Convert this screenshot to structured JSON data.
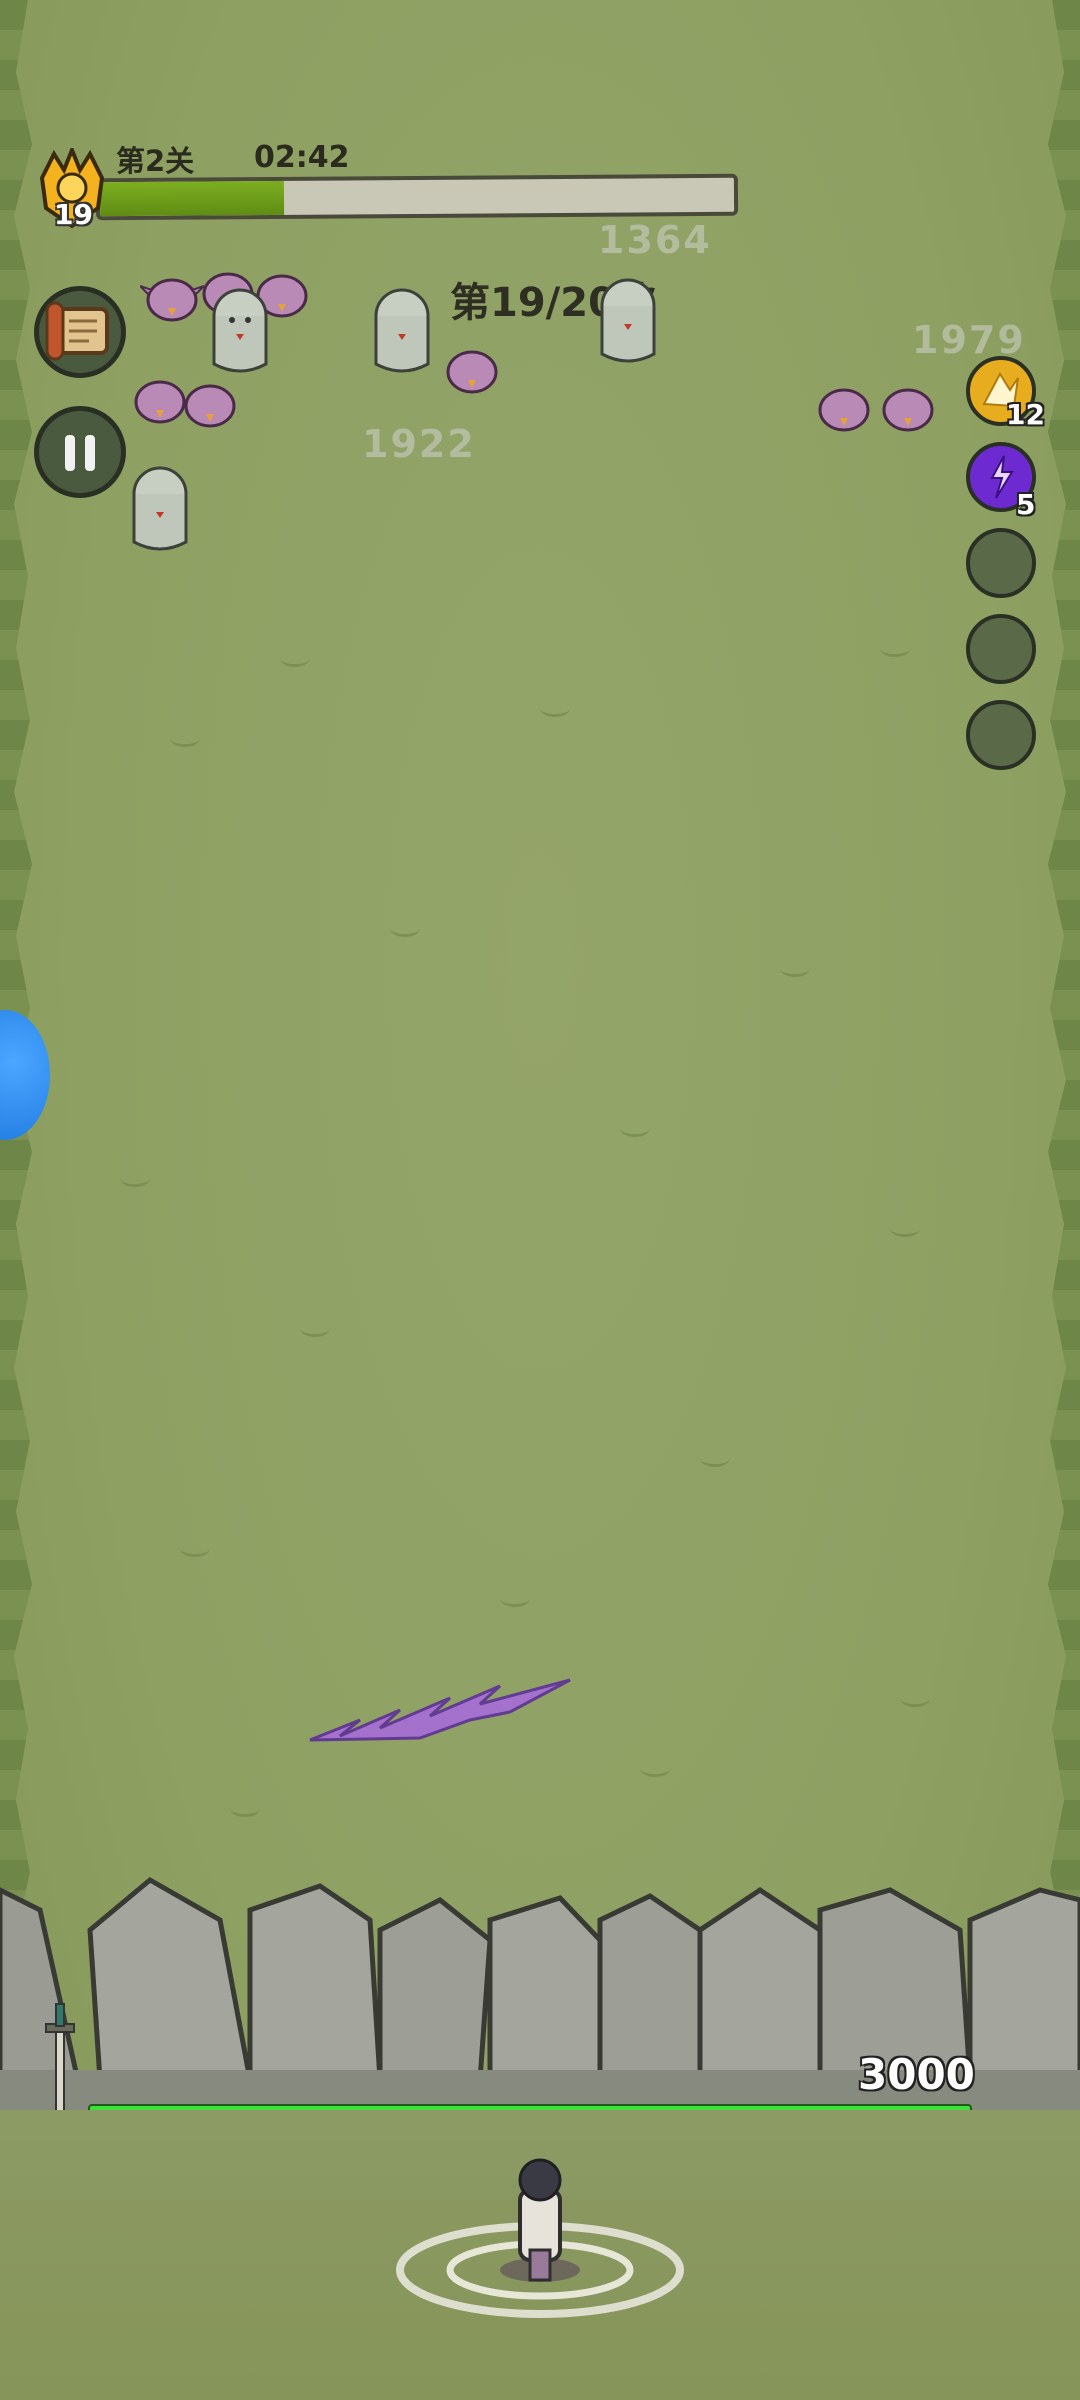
{
  "hud": {
    "player_level": "19",
    "stage_label": "第2关",
    "timer": "02:42",
    "progress_fraction": 0.29,
    "wave_label": "第19/20波"
  },
  "damage_numbers": [
    "1364",
    "1979",
    "1922"
  ],
  "skills": [
    {
      "icon": "wing-skill-icon",
      "color": "#e7ad1f",
      "count": "12"
    },
    {
      "icon": "lightning-orb-icon",
      "color": "#6d2ad1",
      "count": "5"
    },
    {
      "icon": "empty-slot",
      "color": "#5a6a48",
      "count": ""
    },
    {
      "icon": "empty-slot",
      "color": "#5a6a48",
      "count": ""
    },
    {
      "icon": "empty-slot",
      "color": "#5a6a48",
      "count": ""
    }
  ],
  "wall": {
    "hp": "3000"
  },
  "colors": {
    "progress_fill": "#6ba01b",
    "hp_bar": "#3ee03a",
    "grass": "#8fa066"
  }
}
